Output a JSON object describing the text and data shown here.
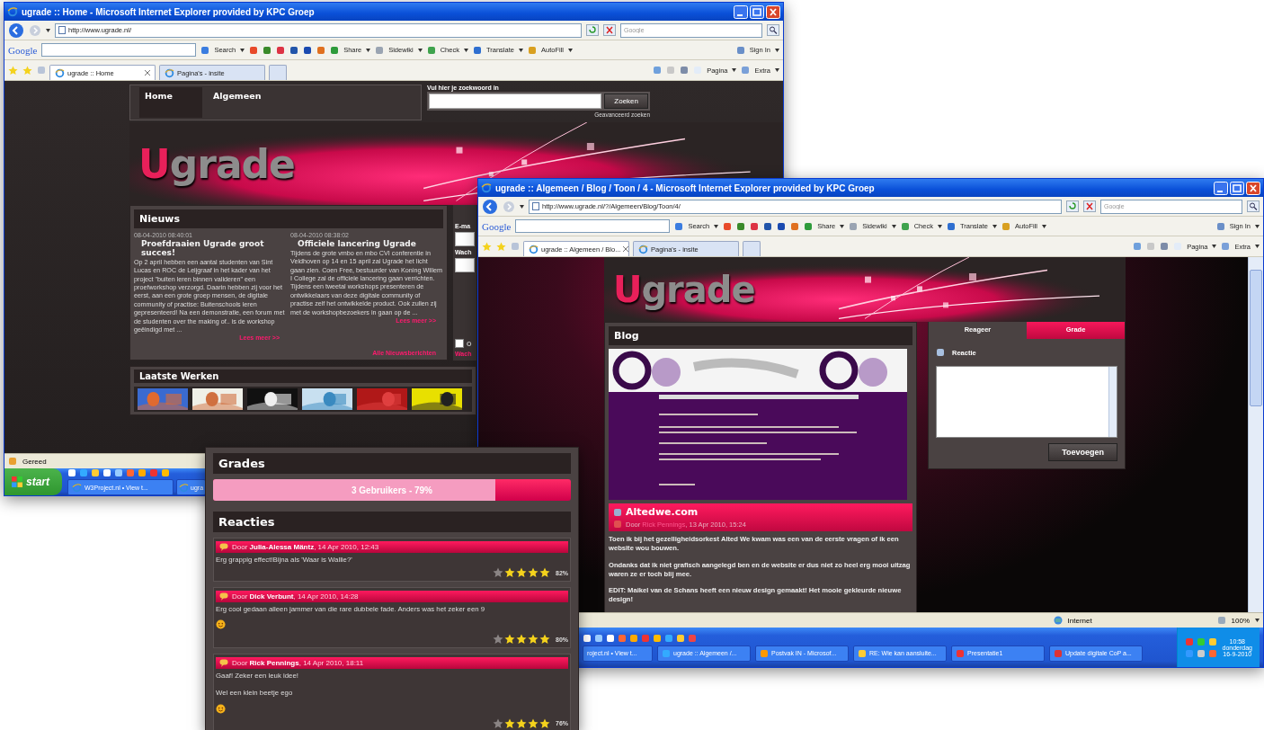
{
  "home_window": {
    "title": "ugrade :: Home - Microsoft Internet Explorer provided by KPC Groep",
    "address": "http://www.ugrade.nl/",
    "search_placeholder": "Google",
    "google_toolbar": {
      "logo": "Google",
      "buttons": [
        "Search",
        "Share",
        "Sidewiki",
        "Check",
        "Translate",
        "AutoFill"
      ],
      "sign_in": "Sign In"
    },
    "tabs": [
      {
        "label": "ugrade :: Home",
        "selected": true
      },
      {
        "label": "Pagina's - insite",
        "selected": false
      }
    ],
    "commands": [
      "Pagina",
      "Extra"
    ],
    "nav": [
      {
        "label": "Home",
        "selected": true
      },
      {
        "label": "Algemeen",
        "selected": false
      }
    ],
    "search": {
      "label": "Vul hier je zoekwoord in",
      "button": "Zoeken",
      "advanced": "Geavanceerd zoeken"
    },
    "logo": {
      "initial": "U",
      "rest": "grade"
    },
    "news": {
      "title": "Nieuws",
      "articles": [
        {
          "date": "08-04-2010 08:40:01",
          "title": "Proefdraaien Ugrade groot succes!",
          "body": "Op 2 april hebben een aantal studenten van Sint Lucas en ROC de Leijgraaf in het kader van het project \"buiten leren binnen valideren\" een proefworkshop verzorgd. Daarin hebben zij voor het eerst, aan een grote groep mensen, de digitale community of practise: Buitenschools leren gepresenteerd! Na een demonstratie, een forum met de studenten over the making of.. is de workshop geëindigd met ...",
          "more": "Lees meer >>"
        },
        {
          "date": "08-04-2010 08:38:02",
          "title": "Officiele lancering Ugrade",
          "body": "Tijdens de grote vmbo en mbo CVI conferentie in Veldhoven op 14 en 15 april zal Ugrade het licht gaan zien. Coen Free, bestuurder van Koning Willem I College zal de officiele lancering gaan verrichten. Tijdens een tweetal workshops presenteren de ontwikkelaars van deze digitale community of practise zelf het ontwikkelde product. Ook zullen zij met de workshopbezoekers in gaan op de ...",
          "more": "Lees meer >>"
        }
      ],
      "all_link": "Alle Nieuwsberichten"
    },
    "login": {
      "email_label": "E-ma",
      "password_label": "Wach",
      "remember": {
        "label": "O",
        "checked": false
      },
      "forgot_link": "Wach"
    },
    "works": {
      "title": "Laatste Werken"
    },
    "status": "Gereed",
    "taskbar": {
      "start": "start",
      "tasks": [
        "W3Project.nl • View t...",
        "ugra"
      ]
    }
  },
  "blog_window": {
    "title": "ugrade :: Algemeen / Blog / Toon / 4 - Microsoft Internet Explorer provided by KPC Groep",
    "address": "http://www.ugrade.nl/?/Algemeen/Blog/Toon/4/",
    "search_placeholder": "Google",
    "google_toolbar": {
      "logo": "Google",
      "buttons": [
        "Search",
        "Share",
        "Sidewiki",
        "Check",
        "Translate",
        "AutoFill"
      ],
      "sign_in": "Sign In"
    },
    "tabs": [
      {
        "label": "ugrade :: Algemeen / Blo...",
        "selected": true
      },
      {
        "label": "Pagina's - insite",
        "selected": false
      }
    ],
    "commands": [
      "Pagina",
      "Extra"
    ],
    "logo": {
      "initial": "U",
      "rest": "grade"
    },
    "blog": {
      "title": "Blog",
      "post": {
        "title": "Altedwe.com",
        "by": "Door ",
        "author": "Rick Pennings",
        "date": ", 13 Apr 2010, 15:24",
        "paragraphs": [
          "Toen ik bij het gezelligheidsorkest Alted We kwam was een van de eerste vragen of ik een website wou bouwen.",
          "Ondanks dat ik niet grafisch aangelegd ben en de website er dus niet zo heel erg mooi uitzag waren ze er toch blij mee.",
          "EDIT: Maikel van de Schans heeft een nieuw design gemaakt! Het mooie gekleurde nieuwe design!"
        ]
      }
    },
    "side": {
      "tabs": [
        {
          "label": "Reageer",
          "selected": true
        },
        {
          "label": "Grade",
          "selected": false
        }
      ],
      "label": "Reactie",
      "button": "Toevoegen"
    },
    "status": {
      "zone": "Internet",
      "zoom": "100%"
    },
    "taskbar": {
      "tasks": [
        "roject.nl • View t...",
        "ugrade :: Algemeen /...",
        "Postvak IN - Microsof...",
        "RE: Wie kan aansluite...",
        "Presentatie1",
        "Update digitale CoP a..."
      ],
      "time": "10:58",
      "day": "donderdag",
      "date": "16-9-2010"
    }
  },
  "grades_panel": {
    "title": "Grades",
    "bar": {
      "label": "3 Gebruikers - 79%",
      "level": 0.79
    },
    "reactions_title": "Reacties",
    "reactions": [
      {
        "by": "Door ",
        "author": "Julia-Alessa Mäntz",
        "date": ", 14 Apr 2010, 12:43",
        "lines": [
          "Erg grappig effect!Bijna als 'Waar is Wallie?'"
        ],
        "emoticon": false,
        "stars": 4,
        "percent": "82%"
      },
      {
        "by": "Door ",
        "author": "Dick Verbunt",
        "date": ", 14 Apr 2010, 14:28",
        "lines": [
          "Erg cool gedaan alleen jammer van die rare dubbele fade. Anders was het zeker een 9"
        ],
        "emoticon": true,
        "stars": 4,
        "percent": "80%"
      },
      {
        "by": "Door ",
        "author": "Rick Pennings",
        "date": ", 14 Apr 2010, 18:11",
        "lines": [
          "Gaaf! Zeker een leuk idee!",
          "Wel een klein beetje ego"
        ],
        "emoticon": true,
        "stars": 4,
        "percent": "76%"
      }
    ]
  }
}
